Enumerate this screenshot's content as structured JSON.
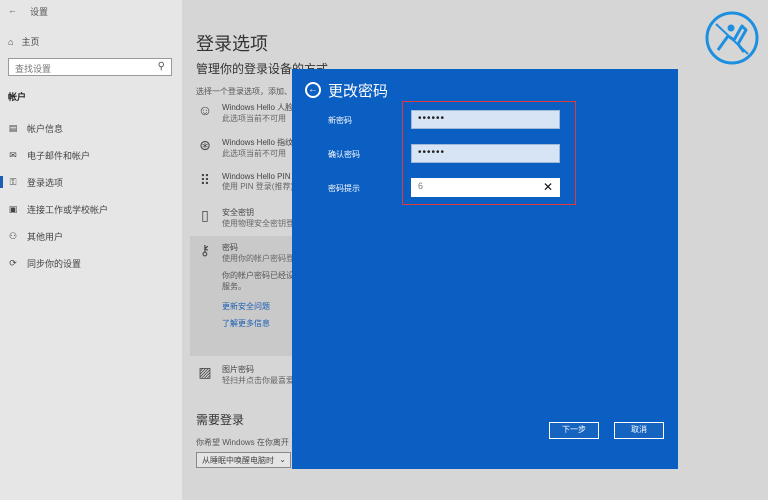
{
  "window": {
    "title": "设置"
  },
  "sidebar": {
    "home": "主页",
    "search_placeholder": "查找设置",
    "section": "帐户",
    "items": [
      {
        "label": "帐户信息",
        "icon": "person-card-icon"
      },
      {
        "label": "电子邮件和帐户",
        "icon": "mail-icon"
      },
      {
        "label": "登录选项",
        "icon": "key-icon",
        "active": true
      },
      {
        "label": "连接工作或学校帐户",
        "icon": "briefcase-icon"
      },
      {
        "label": "其他用户",
        "icon": "person-add-icon"
      },
      {
        "label": "同步你的设置",
        "icon": "sync-icon"
      }
    ]
  },
  "main": {
    "page_title": "登录选项",
    "subtitle": "管理你的登录设备的方式",
    "intro": "选择一个登录选项，添加、",
    "options": [
      {
        "title": "Windows Hello 人脸",
        "desc": "此选项当前不可用",
        "icon": "smile-face-icon"
      },
      {
        "title": "Windows Hello 指纹",
        "desc": "此选项当前不可用",
        "icon": "fingerprint-icon"
      },
      {
        "title": "Windows Hello PIN",
        "desc": "使用 PIN 登录(推荐)",
        "icon": "keypad-icon"
      },
      {
        "title": "安全密钥",
        "desc": "使用物理安全密钥登",
        "icon": "usb-key-icon"
      },
      {
        "title": "密码",
        "desc": "使用你的帐户密码登",
        "icon": "key-icon"
      }
    ],
    "password_note_1": "你的帐户密码已经设",
    "password_note_2": "服务。",
    "link_security": "更新安全问题",
    "link_learn": "了解更多信息",
    "picture_title": "图片密码",
    "picture_desc": "轻扫并点击你最喜爱",
    "require_title": "需要登录",
    "require_desc": "你希望 Windows 在你离开",
    "dropdown_value": "从睡眠中唤醒电脑时"
  },
  "modal": {
    "title": "更改密码",
    "new_password_label": "新密码",
    "new_password_value": "••••••",
    "confirm_label": "确认密码",
    "confirm_value": "••••••",
    "hint_label": "密码提示",
    "hint_value": "6",
    "next_button": "下一步",
    "cancel_button": "取消"
  },
  "colors": {
    "modal_bg": "#0b5ec2",
    "highlight_box": "#e23a3a",
    "accent": "#1a5fb4"
  }
}
